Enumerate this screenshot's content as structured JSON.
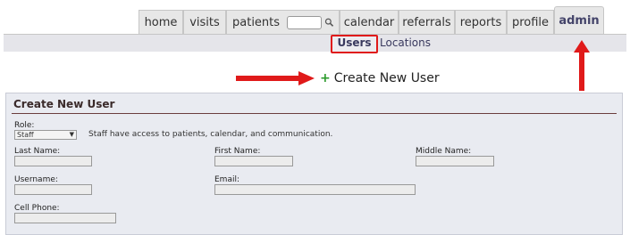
{
  "tabs": [
    {
      "label": "home"
    },
    {
      "label": "visits"
    },
    {
      "label": "patients"
    },
    {
      "label": "calendar"
    },
    {
      "label": "referrals"
    },
    {
      "label": "reports"
    },
    {
      "label": "profile"
    },
    {
      "label": "admin"
    }
  ],
  "subnav": {
    "users": "Users",
    "locations": "Locations"
  },
  "create_link": "Create New User",
  "form": {
    "title": "Create New User",
    "role_label": "Role:",
    "role_value": "Staff",
    "role_hint": "Staff have access to patients, calendar, and communication.",
    "last_name_label": "Last Name:",
    "first_name_label": "First Name:",
    "middle_name_label": "Middle Name:",
    "username_label": "Username:",
    "email_label": "Email:",
    "cell_label": "Cell Phone:"
  },
  "colors": {
    "arrow": "#e01a1a",
    "plus": "#2b9a2b",
    "tab_bg": "#e7e7e7"
  }
}
